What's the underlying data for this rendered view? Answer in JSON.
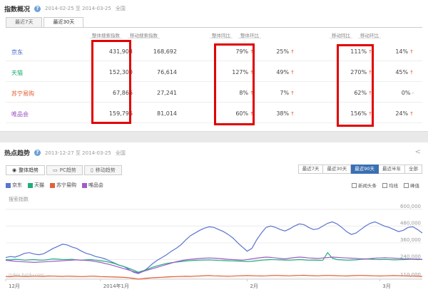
{
  "top": {
    "title": "指数概况",
    "date_range": "2014-02-25 至 2014-03-25",
    "scope": "全国",
    "tabs": [
      {
        "label": "最近7天",
        "active": false
      },
      {
        "label": "最近30天",
        "active": true
      }
    ],
    "headers": {
      "search_total": "整体搜索指数",
      "search_mobile": "移动搜索指数",
      "yoy_total": "整体同比",
      "mom_total": "整体环比",
      "yoy_mobile": "移动同比",
      "mom_mobile": "移动环比"
    },
    "rows": [
      {
        "brand": "京东",
        "color": "#3a5ec7",
        "search_total": "431,903",
        "search_mobile": "168,692",
        "yoy_total": "79%",
        "mom_total": "25%",
        "yoy_mobile": "111%",
        "mom_mobile": "14%"
      },
      {
        "brand": "天猫",
        "color": "#17a86a",
        "search_total": "152,300",
        "search_mobile": "76,614",
        "yoy_total": "127%",
        "mom_total": "49%",
        "yoy_mobile": "270%",
        "mom_mobile": "45%"
      },
      {
        "brand": "苏宁易购",
        "color": "#e25a2c",
        "search_total": "67,866",
        "search_mobile": "27,241",
        "yoy_total": "8%",
        "mom_total": "7%",
        "yoy_mobile": "62%",
        "mom_mobile": "0%"
      },
      {
        "brand": "唯品会",
        "color": "#9b4fc0",
        "search_total": "159,796",
        "search_mobile": "81,014",
        "yoy_total": "60%",
        "mom_total": "38%",
        "yoy_mobile": "156%",
        "mom_mobile": "24%"
      }
    ],
    "up_arrow": "↑",
    "dash": "-"
  },
  "bottom": {
    "title": "热点趋势",
    "date_range": "2013-12-27 至 2014-03-25",
    "scope": "全国",
    "share_icon": "share-icon",
    "tabs": [
      {
        "label": "整体趋势",
        "active": true
      },
      {
        "label": "PC趋势",
        "active": false
      },
      {
        "label": "移动趋势",
        "active": false
      }
    ],
    "ranges": [
      {
        "label": "最近7天",
        "active": false
      },
      {
        "label": "最近30天",
        "active": false
      },
      {
        "label": "最近90天",
        "active": true
      },
      {
        "label": "最近半年",
        "active": false
      },
      {
        "label": "全部",
        "active": false
      }
    ],
    "checks": [
      "新闻头条",
      "均线",
      "峰值"
    ],
    "watermark": "index.baidu.com"
  },
  "chart_data": {
    "type": "line",
    "ylabel": "搜索指数",
    "ylim": [
      100000,
      650000
    ],
    "y_ticks": [
      {
        "value": 600000,
        "label": "600,000"
      },
      {
        "value": 480000,
        "label": "480,000"
      },
      {
        "value": 360000,
        "label": "360,000"
      },
      {
        "value": 240000,
        "label": "240,000"
      },
      {
        "value": 110000,
        "label": "110,000"
      }
    ],
    "x_ticks": [
      {
        "i": 0,
        "label": "12月"
      },
      {
        "i": 20,
        "label": "2014年1月"
      },
      {
        "i": 51,
        "label": "2月"
      },
      {
        "i": 79,
        "label": "3月"
      }
    ],
    "n_points": 89,
    "series": [
      {
        "name": "京东",
        "color": "#5b74cf",
        "values": [
          255000,
          262000,
          258000,
          270000,
          285000,
          290000,
          280000,
          275000,
          282000,
          300000,
          320000,
          335000,
          350000,
          345000,
          330000,
          320000,
          300000,
          285000,
          275000,
          262000,
          255000,
          245000,
          230000,
          215000,
          200000,
          190000,
          170000,
          150000,
          140000,
          155000,
          180000,
          210000,
          235000,
          255000,
          275000,
          300000,
          320000,
          345000,
          380000,
          410000,
          430000,
          450000,
          465000,
          475000,
          470000,
          455000,
          440000,
          420000,
          395000,
          360000,
          330000,
          300000,
          320000,
          380000,
          430000,
          470000,
          480000,
          470000,
          455000,
          445000,
          460000,
          480000,
          495000,
          490000,
          470000,
          455000,
          460000,
          480000,
          500000,
          510000,
          495000,
          470000,
          440000,
          420000,
          430000,
          455000,
          480000,
          500000,
          510000,
          495000,
          480000,
          470000,
          455000,
          440000,
          450000,
          470000,
          475000,
          455000,
          430000
        ]
      },
      {
        "name": "天猫",
        "color": "#1fae78",
        "values": [
          240000,
          238000,
          242000,
          240000,
          236000,
          238000,
          240000,
          237000,
          236000,
          240000,
          245000,
          243000,
          241000,
          240000,
          242000,
          238000,
          236000,
          238000,
          240000,
          236000,
          232000,
          228000,
          220000,
          212000,
          200000,
          190000,
          178000,
          165000,
          150000,
          160000,
          172000,
          185000,
          195000,
          205000,
          212000,
          218000,
          222000,
          226000,
          230000,
          233000,
          235000,
          236000,
          237000,
          238000,
          236000,
          234000,
          233000,
          232000,
          231000,
          230000,
          228000,
          226000,
          228000,
          232000,
          236000,
          238000,
          240000,
          239000,
          238000,
          237000,
          236000,
          238000,
          240000,
          238000,
          236000,
          237000,
          235000,
          236000,
          290000,
          250000,
          240000,
          238000,
          236000,
          237000,
          238000,
          242000,
          244000,
          243000,
          241000,
          240000,
          242000,
          240000,
          238000,
          239000,
          240000,
          242000,
          243000,
          240000,
          241000
        ]
      },
      {
        "name": "苏宁易购",
        "color": "#e3613a",
        "values": [
          120000,
          118000,
          122000,
          121000,
          119000,
          120000,
          122000,
          121000,
          120000,
          123000,
          122000,
          121000,
          120000,
          122000,
          121000,
          120000,
          119000,
          120000,
          122000,
          121000,
          119000,
          118000,
          117000,
          116000,
          115000,
          113000,
          110000,
          105000,
          100000,
          103000,
          107000,
          110000,
          112000,
          114000,
          116000,
          118000,
          119000,
          120000,
          121000,
          120000,
          122000,
          123000,
          125000,
          126000,
          124000,
          123000,
          122000,
          121000,
          122000,
          124000,
          125000,
          126000,
          125000,
          124000,
          123000,
          124000,
          126000,
          127000,
          126000,
          125000,
          124000,
          126000,
          127000,
          128000,
          126000,
          125000,
          124000,
          126000,
          127000,
          126000,
          125000,
          124000,
          123000,
          125000,
          126000,
          127000,
          126000,
          125000,
          124000,
          123000,
          124000,
          125000,
          126000,
          125000,
          124000,
          123000,
          122000,
          121000,
          120000
        ]
      },
      {
        "name": "唯品会",
        "color": "#a05cc9",
        "values": [
          235000,
          232000,
          228000,
          226000,
          224000,
          222000,
          220000,
          222000,
          224000,
          226000,
          228000,
          230000,
          232000,
          234000,
          236000,
          238000,
          236000,
          234000,
          232000,
          226000,
          220000,
          212000,
          205000,
          195000,
          185000,
          175000,
          165000,
          155000,
          145000,
          155000,
          165000,
          175000,
          185000,
          195000,
          205000,
          215000,
          225000,
          232000,
          238000,
          242000,
          245000,
          248000,
          250000,
          252000,
          250000,
          248000,
          245000,
          242000,
          240000,
          238000,
          236000,
          240000,
          245000,
          250000,
          255000,
          258000,
          256000,
          252000,
          248000,
          245000,
          250000,
          255000,
          258000,
          256000,
          252000,
          250000,
          248000,
          252000,
          255000,
          258000,
          256000,
          254000,
          252000,
          250000,
          248000,
          246000,
          245000,
          247000,
          250000,
          252000,
          254000,
          252000,
          250000,
          248000,
          246000,
          245000,
          244000,
          243000,
          242000
        ]
      }
    ]
  }
}
